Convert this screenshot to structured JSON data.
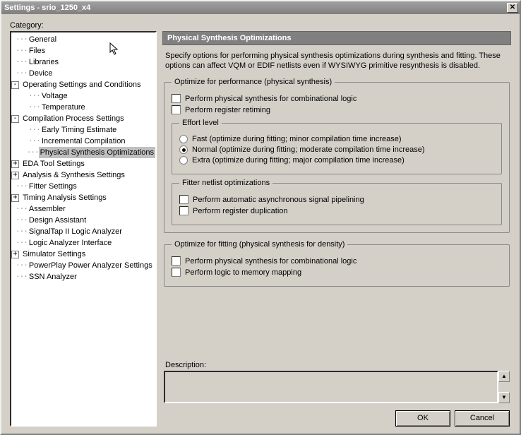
{
  "window": {
    "title": "Settings - srio_1250_x4"
  },
  "category_label": "Category:",
  "tree": {
    "general": "General",
    "files": "Files",
    "libraries": "Libraries",
    "device": "Device",
    "operating": "Operating Settings and Conditions",
    "voltage": "Voltage",
    "temperature": "Temperature",
    "compilation": "Compilation Process Settings",
    "early_timing": "Early Timing Estimate",
    "incremental": "Incremental Compilation",
    "phys_synth": "Physical Synthesis Optimizations",
    "eda": "EDA Tool Settings",
    "analysis": "Analysis & Synthesis Settings",
    "fitter": "Fitter Settings",
    "timing": "Timing Analysis Settings",
    "assembler": "Assembler",
    "design_assist": "Design Assistant",
    "signaltap": "SignalTap II Logic Analyzer",
    "logic_analyzer": "Logic Analyzer Interface",
    "simulator": "Simulator Settings",
    "powerplay": "PowerPlay Power Analyzer Settings",
    "ssn": "SSN Analyzer"
  },
  "panel": {
    "title": "Physical Synthesis Optimizations",
    "intro": "Specify options for performing physical synthesis optimizations during synthesis and fitting. These options can affect VQM or EDIF netlists even if WYSIWYG primitive resynthesis is disabled.",
    "group_perf": "Optimize for performance (physical synthesis)",
    "cb_perf_comb": "Perform physical synthesis for combinational logic",
    "cb_perf_retime": "Perform register retiming",
    "group_effort": "Effort level",
    "rb_fast": "Fast (optimize during fitting; minor compilation time increase)",
    "rb_normal": "Normal (optimize during fitting; moderate compilation time increase)",
    "rb_extra": "Extra (optimize during fitting; major compilation time increase)",
    "group_fitter": "Fitter netlist optimizations",
    "cb_fit_pipe": "Perform automatic asynchronous signal pipelining",
    "cb_fit_dup": "Perform register duplication",
    "group_density": "Optimize for fitting (physical synthesis for density)",
    "cb_dens_comb": "Perform physical synthesis for combinational logic",
    "cb_dens_mem": "Perform logic to memory mapping",
    "desc_label": "Description:"
  },
  "buttons": {
    "ok": "OK",
    "cancel": "Cancel"
  },
  "effort_selected": "normal"
}
